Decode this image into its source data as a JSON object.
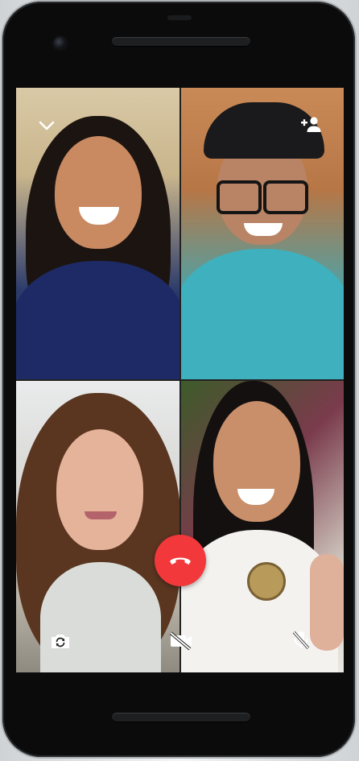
{
  "call": {
    "participants": [
      {
        "tile": "top-left"
      },
      {
        "tile": "top-right"
      },
      {
        "tile": "bottom-left"
      },
      {
        "tile": "bottom-right"
      }
    ]
  },
  "controls": {
    "top": [
      {
        "icon": "chevron-down-icon"
      },
      {
        "icon": "add-participant-icon"
      }
    ],
    "bottom": [
      {
        "icon": "switch-camera-icon"
      },
      {
        "icon": "video-off-icon"
      },
      {
        "icon": "mic-off-icon"
      }
    ],
    "end_call": {
      "icon": "end-call-icon",
      "color": "#f2383a"
    }
  },
  "colors": {
    "icon": "#ffffff",
    "end_call": "#f2383a",
    "bezel": "#0b0b0c"
  }
}
